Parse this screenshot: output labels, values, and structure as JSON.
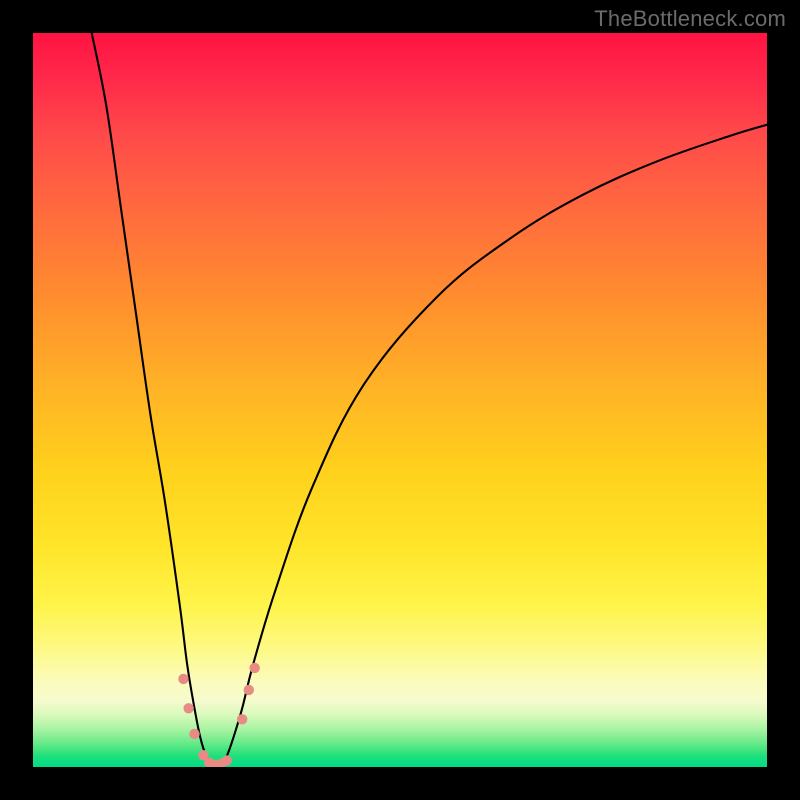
{
  "watermark": "TheBottleneck.com",
  "chart_data": {
    "type": "line",
    "title": "",
    "xlabel": "",
    "ylabel": "",
    "xlim": [
      0,
      100
    ],
    "ylim": [
      0,
      100
    ],
    "grid": false,
    "legend": false,
    "background_gradient": {
      "direction": "top-to-bottom",
      "stops": [
        {
          "pos": 0,
          "color": "#ff1342"
        },
        {
          "pos": 50,
          "color": "#ffcc20"
        },
        {
          "pos": 85,
          "color": "#fff976"
        },
        {
          "pos": 100,
          "color": "#00dc85"
        }
      ]
    },
    "series": [
      {
        "name": "bottleneck-curve",
        "color": "#000000",
        "x": [
          8,
          10,
          12,
          14,
          16,
          18,
          20,
          21,
          22,
          22.8,
          23.6,
          24.4,
          25,
          25.6,
          26.4,
          27.3,
          28.5,
          30,
          33,
          38,
          45,
          55,
          65,
          75,
          85,
          95,
          100
        ],
        "y": [
          100,
          90,
          76,
          62,
          48,
          36,
          22,
          14,
          8,
          4,
          1.5,
          0.5,
          0.3,
          0.5,
          1.5,
          4,
          8,
          14,
          24,
          38,
          52,
          64,
          72,
          78,
          82.5,
          86,
          87.5
        ]
      }
    ],
    "markers": {
      "name": "highlighted-points",
      "color": "#e78b84",
      "radius": 5.2,
      "points": [
        {
          "x": 20.5,
          "y": 12.0
        },
        {
          "x": 21.2,
          "y": 8.0
        },
        {
          "x": 22.0,
          "y": 4.5
        },
        {
          "x": 23.2,
          "y": 1.6
        },
        {
          "x": 24.0,
          "y": 0.6
        },
        {
          "x": 24.8,
          "y": 0.3
        },
        {
          "x": 25.6,
          "y": 0.4
        },
        {
          "x": 26.4,
          "y": 0.9
        },
        {
          "x": 28.5,
          "y": 6.5
        },
        {
          "x": 29.4,
          "y": 10.5
        },
        {
          "x": 30.2,
          "y": 13.5
        }
      ]
    }
  }
}
